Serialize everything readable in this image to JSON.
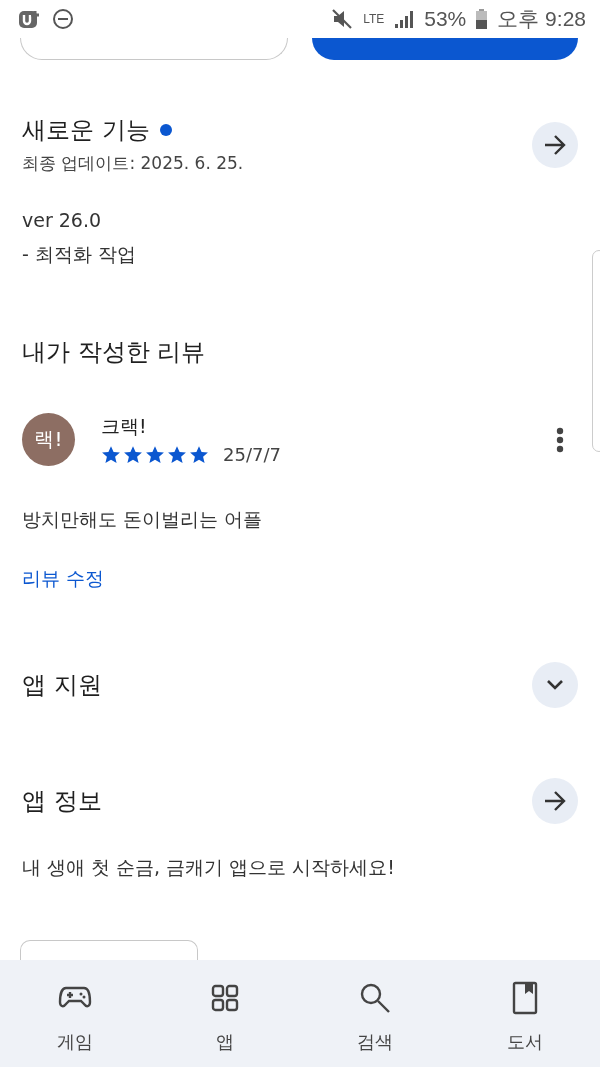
{
  "status_bar": {
    "battery": "53%",
    "time": "오후 9:28",
    "network": "LTE"
  },
  "whats_new": {
    "title": "새로운 기능",
    "updated": "최종 업데이트: 2025. 6. 25.",
    "lines": [
      "ver 26.0",
      "- 최적화 작업"
    ]
  },
  "my_review": {
    "title": "내가 작성한 리뷰",
    "avatar": "랙!",
    "author": "크랙!",
    "stars": 5,
    "date": "25/7/7",
    "text": "방치만해도 돈이벌리는 어플",
    "edit_link": "리뷰 수정"
  },
  "sections": [
    {
      "title": "앱 지원",
      "kind": "expand"
    },
    {
      "title": "앱 정보",
      "kind": "arrow",
      "text": "내 생애 첫 순금, 금캐기 앱으로 시작하세요!"
    }
  ],
  "bottom_nav": [
    {
      "label": "게임",
      "kind": "games"
    },
    {
      "label": "앱",
      "kind": "apps"
    },
    {
      "label": "검색",
      "kind": "search"
    },
    {
      "label": "도서",
      "kind": "books"
    }
  ]
}
